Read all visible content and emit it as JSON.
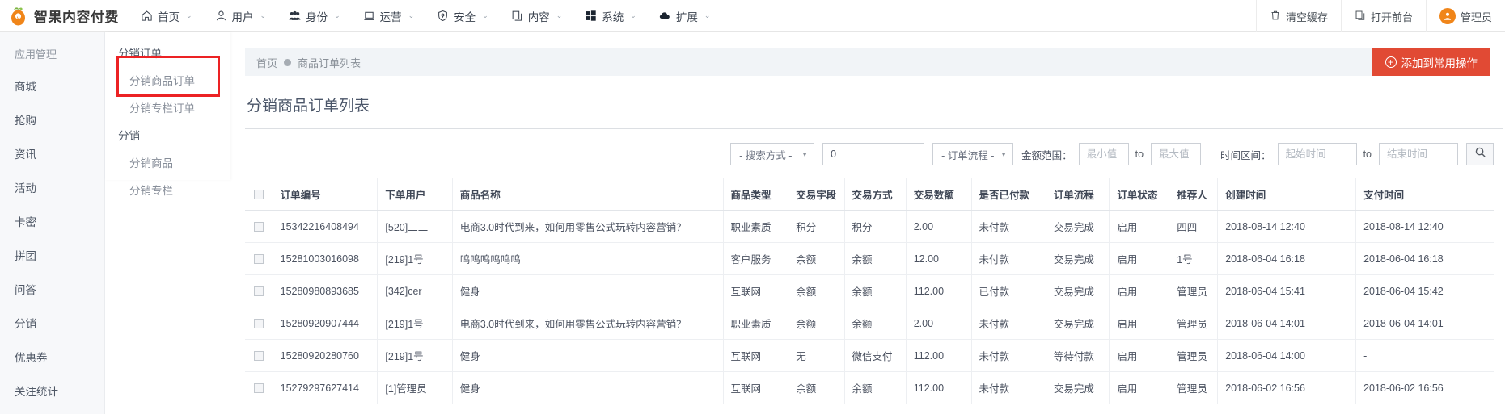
{
  "brand": {
    "name": "智果内容付费",
    "logo_icon": "carrot-logo-icon"
  },
  "topnav": [
    {
      "label": "首页",
      "icon": "home-icon",
      "caret": "⌄"
    },
    {
      "label": "用户",
      "icon": "user-icon",
      "caret": "⌄"
    },
    {
      "label": "身份",
      "icon": "group-icon",
      "caret": "⌄"
    },
    {
      "label": "运营",
      "icon": "monitor-icon",
      "caret": "⌄"
    },
    {
      "label": "安全",
      "icon": "shield-icon",
      "caret": "⌄"
    },
    {
      "label": "内容",
      "icon": "copy-icon",
      "caret": "⌄"
    },
    {
      "label": "系统",
      "icon": "windows-icon",
      "caret": "⌄"
    },
    {
      "label": "扩展",
      "icon": "cloud-icon",
      "caret": "⌄"
    }
  ],
  "topright": [
    {
      "label": "清空缓存",
      "icon": "trash-icon"
    },
    {
      "label": "打开前台",
      "icon": "copy-icon"
    },
    {
      "label": "管理员",
      "icon": "avatar-icon"
    }
  ],
  "sidebar": {
    "header": "应用管理",
    "items": [
      {
        "label": "商城"
      },
      {
        "label": "抢购"
      },
      {
        "label": "资讯"
      },
      {
        "label": "活动"
      },
      {
        "label": "卡密"
      },
      {
        "label": "拼团"
      },
      {
        "label": "问答"
      },
      {
        "label": "分销"
      },
      {
        "label": "优惠券"
      },
      {
        "label": "关注统计"
      }
    ]
  },
  "flyout": {
    "groups": [
      {
        "title": "分销订单",
        "items": [
          {
            "label": "分销商品订单"
          },
          {
            "label": "分销专栏订单"
          }
        ]
      },
      {
        "title": "分销",
        "items": [
          {
            "label": "分销商品"
          },
          {
            "label": "分销专栏"
          }
        ]
      }
    ],
    "highlight_color": "#ec2224"
  },
  "breadcrumb": {
    "home": "首页",
    "current": "商品订单列表"
  },
  "actions": {
    "add_common": "添加到常用操作",
    "add_icon": "plus-circle-icon"
  },
  "page": {
    "title": "分销商品订单列表"
  },
  "filters": {
    "search_mode": "- 搜索方式 -",
    "keyword_value": "0",
    "keyword_placeholder": "",
    "order_flow": "- 订单流程 -",
    "amount_label": "金额范围：",
    "amount_min_placeholder": "最小值",
    "amount_max_placeholder": "最大值",
    "to": "to",
    "time_label": "时间区间：",
    "time_start_placeholder": "起始时间",
    "time_end_placeholder": "结束时间",
    "search_icon": "search-icon"
  },
  "table": {
    "columns": [
      "",
      "订单编号",
      "下单用户",
      "商品名称",
      "商品类型",
      "交易字段",
      "交易方式",
      "交易数额",
      "是否已付款",
      "订单流程",
      "订单状态",
      "推荐人",
      "创建时间",
      "支付时间"
    ],
    "rows": [
      {
        "order_no": "15342216408494",
        "user": "[520]二二",
        "goods": "电商3.0时代到来，如何用零售公式玩转内容营销？",
        "goods_type": "职业素质",
        "trade_field": "积分",
        "trade_way": "积分",
        "amount": "2.00",
        "paid": "未付款",
        "flow": "交易完成",
        "status": "启用",
        "referrer": "四四",
        "created": "2018-08-14 12:40",
        "paid_time": "2018-08-14 12:40"
      },
      {
        "order_no": "15281003016098",
        "user": "[219]1号",
        "goods": "呜呜呜呜呜呜",
        "goods_type": "客户服务",
        "trade_field": "余额",
        "trade_way": "余额",
        "amount": "12.00",
        "paid": "未付款",
        "flow": "交易完成",
        "status": "启用",
        "referrer": "1号",
        "created": "2018-06-04 16:18",
        "paid_time": "2018-06-04 16:18"
      },
      {
        "order_no": "15280980893685",
        "user": "[342]cer",
        "goods": "健身",
        "goods_type": "互联网",
        "trade_field": "余额",
        "trade_way": "余额",
        "amount": "112.00",
        "paid": "已付款",
        "flow": "交易完成",
        "status": "启用",
        "referrer": "管理员",
        "created": "2018-06-04 15:41",
        "paid_time": "2018-06-04 15:42"
      },
      {
        "order_no": "15280920907444",
        "user": "[219]1号",
        "goods": "电商3.0时代到来，如何用零售公式玩转内容营销？",
        "goods_type": "职业素质",
        "trade_field": "余额",
        "trade_way": "余额",
        "amount": "2.00",
        "paid": "未付款",
        "flow": "交易完成",
        "status": "启用",
        "referrer": "管理员",
        "created": "2018-06-04 14:01",
        "paid_time": "2018-06-04 14:01"
      },
      {
        "order_no": "15280920280760",
        "user": "[219]1号",
        "goods": "健身",
        "goods_type": "互联网",
        "trade_field": "无",
        "trade_way": "微信支付",
        "amount": "112.00",
        "paid": "未付款",
        "flow": "等待付款",
        "status": "启用",
        "referrer": "管理员",
        "created": "2018-06-04 14:00",
        "paid_time": "-"
      },
      {
        "order_no": "15279297627414",
        "user": "[1]管理员",
        "goods": "健身",
        "goods_type": "互联网",
        "trade_field": "余额",
        "trade_way": "余额",
        "amount": "112.00",
        "paid": "未付款",
        "flow": "交易完成",
        "status": "启用",
        "referrer": "管理员",
        "created": "2018-06-02 16:56",
        "paid_time": "2018-06-02 16:56"
      }
    ]
  },
  "colors": {
    "brand_orange": "#f08519",
    "action_red": "#e14a34",
    "highlight_red": "#ec2224"
  }
}
